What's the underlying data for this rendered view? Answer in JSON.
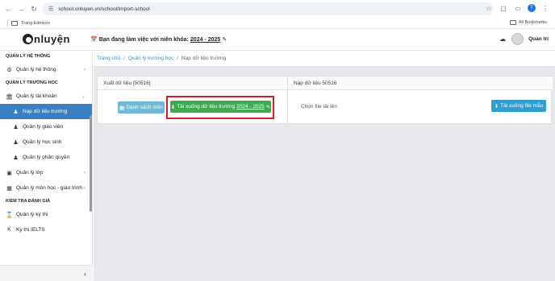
{
  "browser": {
    "url": "school.onluyen.vn/school/import-school",
    "bookmark_folder": "Trang Edmicro",
    "all_bookmarks": "All Bookmarks",
    "profile_initial": "T"
  },
  "header": {
    "logo_text": "nluyện",
    "school_year_label": "Bạn đang làm việc với niên khóa:",
    "school_year_value": "2024 - 2025",
    "user_name": "Quản trị"
  },
  "sidebar": {
    "sections": [
      {
        "title": "QUẢN LÝ HỆ THỐNG"
      },
      {
        "title": "QUẢN LÝ TRƯỜNG HỌC"
      },
      {
        "title": "KIỂM TRA ĐÁNH GIÁ"
      }
    ],
    "items": [
      {
        "label": "Quản lý hệ thống",
        "icon": "gears-icon"
      },
      {
        "label": "Quản lý tài khoản",
        "icon": "bank-icon"
      },
      {
        "label": "Nạp dữ liệu trường",
        "icon": "user-icon"
      },
      {
        "label": "Quản lý giáo viên",
        "icon": "teacher-icon"
      },
      {
        "label": "Quản lý học sinh",
        "icon": "users-icon"
      },
      {
        "label": "Quản lý phân quyền",
        "icon": "user-key-icon"
      },
      {
        "label": "Quản lý lớp",
        "icon": "class-icon"
      },
      {
        "label": "Quản lý môn học - giáo trình",
        "icon": "book-icon"
      },
      {
        "label": "Quản lý kỳ thi",
        "icon": "hourglass-icon"
      },
      {
        "label": "Kỳ thi IELTS",
        "icon": "k-icon"
      }
    ]
  },
  "breadcrumb": {
    "home": "Trang chủ",
    "parent": "Quản lý trường học",
    "current": "Nạp dữ liệu trường"
  },
  "export_panel": {
    "title": "Xuất dữ liệu [50516]",
    "subject_list_button": "Danh sách môn",
    "download_button_prefix": "Tải xuống dữ liệu trường",
    "download_button_year": "2024 - 2025"
  },
  "import_panel": {
    "title": "Nạp dữ liệu 50516",
    "choose_file_text": "Chọn file tải lên",
    "template_button": "Tải xuống file mẫu"
  },
  "colors": {
    "active_sidebar": "#3a7fc4",
    "link": "#3a90c8",
    "green_button": "#3ea94f",
    "teal_button": "#6fbad6",
    "blue_button": "#2e9fd1",
    "highlight_box": "#d51d23"
  }
}
